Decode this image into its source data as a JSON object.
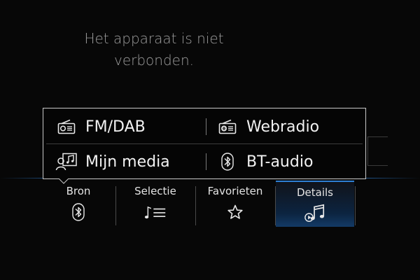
{
  "status_message": {
    "line1": "Het apparaat is niet",
    "line2": "verbonden."
  },
  "source_menu": {
    "items": [
      {
        "label": "FM/DAB",
        "icon": "radio-icon"
      },
      {
        "label": "Webradio",
        "icon": "web-radio-icon"
      },
      {
        "label": "Mijn media",
        "icon": "my-media-icon"
      },
      {
        "label": "BT-audio",
        "icon": "bluetooth-icon"
      }
    ]
  },
  "tabs": [
    {
      "label": "Bron",
      "icon": "bluetooth-icon",
      "active": false
    },
    {
      "label": "Selectie",
      "icon": "playlist-icon",
      "active": false
    },
    {
      "label": "Favorieten",
      "icon": "star-icon",
      "active": false
    },
    {
      "label": "Details",
      "icon": "music-details-icon",
      "active": true
    }
  ],
  "colors": {
    "accent": "#2e7fd3",
    "background": "#070707",
    "message_text": "#9d9d9d"
  }
}
